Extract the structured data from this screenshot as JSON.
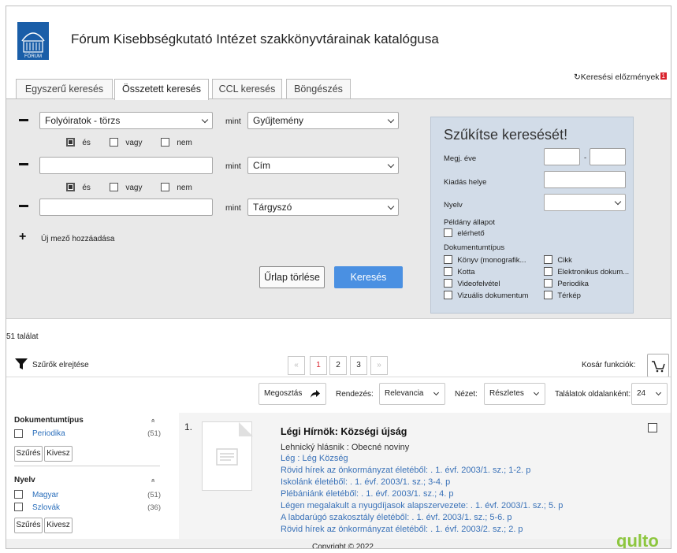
{
  "header": {
    "title": "Fórum Kisebbségkutató Intézet szakkönyvtárainak katalógusa",
    "logo_text": "FÓRUM",
    "history_label": "Keresési előzmények",
    "history_badge": "1"
  },
  "tabs": [
    {
      "label": "Egyszerű keresés"
    },
    {
      "label": "Összetett keresés"
    },
    {
      "label": "CCL keresés"
    },
    {
      "label": "Böngészés"
    }
  ],
  "search": {
    "rows": [
      {
        "value": "Folyóiratok - törzs",
        "mint": "mint",
        "field": "Gyűjtemény"
      },
      {
        "value": "",
        "mint": "mint",
        "field": "Cím"
      },
      {
        "value": "",
        "mint": "mint",
        "field": "Tárgyszó"
      }
    ],
    "operators": {
      "and": "és",
      "or": "vagy",
      "not": "nem"
    },
    "add_field": "Új mező hozzáadása",
    "clear_label": "Űrlap törlése",
    "search_label": "Keresés"
  },
  "refine": {
    "title": "Szűkítse keresését!",
    "year_label": "Megj. éve",
    "year_sep": "-",
    "place_label": "Kiadás helye",
    "lang_label": "Nyelv",
    "copy_status_label": "Példány állapot",
    "available_label": "elérhető",
    "doctype_label": "Dokumentumtípus",
    "doctypes_left": [
      "Könyv (monografik...",
      "Kotta",
      "Videofelvétel",
      "Vizuális dokumentum"
    ],
    "doctypes_right": [
      "Cikk",
      "Elektronikus dokum...",
      "Periodika",
      "Térkép"
    ]
  },
  "results": {
    "count": "51 találat",
    "hide_filters": "Szűrők elrejtése",
    "pages": [
      "«",
      "1",
      "2",
      "3",
      "»"
    ],
    "cart_label": "Kosár funkciók:",
    "share": "Megosztás",
    "sort_label": "Rendezés:",
    "sort_value": "Relevancia",
    "view_label": "Nézet:",
    "view_value": "Részletes",
    "perpage_label": "Találatok oldalanként:",
    "perpage_value": "24"
  },
  "facets": {
    "doctype": {
      "title": "Dokumentumtípus",
      "items": [
        {
          "label": "Periodika",
          "count": "(51)"
        }
      ]
    },
    "lang": {
      "title": "Nyelv",
      "items": [
        {
          "label": "Magyar",
          "count": "(51)"
        },
        {
          "label": "Szlovák",
          "count": "(36)"
        }
      ]
    },
    "filter_btn": "Szűrés",
    "remove_btn": "Kivesz",
    "caret": "»"
  },
  "record": {
    "number": "1.",
    "title": "Légi Hírnök: Községi újság",
    "subtitle": "Lehnický hlásnik : Obecné noviny",
    "lines": [
      "Lég :  Lég Község",
      "Rövid hírek az önkormányzat életéből: . 1. évf. 2003/1. sz.; 1-2. p",
      "Iskolánk életéből: . 1. évf. 2003/1. sz.; 3-4. p",
      "Plébániánk életéből: . 1. évf. 2003/1. sz.; 4. p",
      "Légen megalakult a nyugdíjasok alapszervezete: . 1. évf. 2003/1. sz.; 5. p",
      "A labdarúgó szakosztály életéből: . 1. évf. 2003/1. sz.; 5-6. p",
      "Rövid hírek az önkormányzat életéből: . 1. évf. 2003/2. sz.; 2. p"
    ]
  },
  "footer": {
    "copyright": "Copyright © 2022",
    "brand": "qulto"
  }
}
